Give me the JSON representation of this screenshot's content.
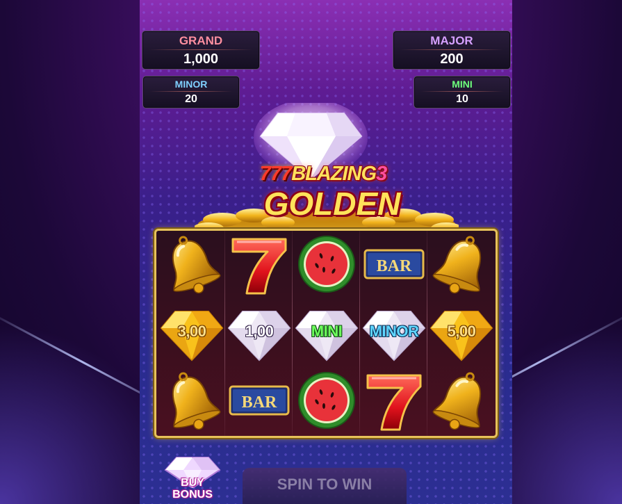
{
  "jackpots": {
    "grand": {
      "label": "GRAND",
      "value": "1,000",
      "color": "#ff8fa0"
    },
    "major": {
      "label": "MAJOR",
      "value": "200",
      "color": "#d6a0ff"
    },
    "minor": {
      "label": "MINOR",
      "value": "20",
      "color": "#7fd0ff"
    },
    "mini": {
      "label": "MINI",
      "value": "10",
      "color": "#6dff7c"
    }
  },
  "logo": {
    "sevens": "777",
    "blazing": "BLAZING",
    "number": "3",
    "golden": "GOLDEN"
  },
  "reels": [
    [
      "bell",
      "gold-gem",
      "bell"
    ],
    [
      "seven",
      "white-gem",
      "bar"
    ],
    [
      "watermelon",
      "white-gem",
      "watermelon"
    ],
    [
      "bar",
      "white-gem",
      "seven"
    ],
    [
      "bell",
      "gold-gem",
      "bell"
    ]
  ],
  "gem_labels": {
    "r0c1": "3,00",
    "r1c1": "1,00",
    "r2c1": "MINI",
    "r3c1": "MINOR",
    "r4c1": "5,00"
  },
  "bar_label": "BAR",
  "buy_bonus": {
    "line1": "BUY",
    "line2": "BONUS"
  },
  "spin_button": "SPIN TO WIN",
  "colors": {
    "frame": "#e7c25a",
    "gold": "#ffd23a",
    "gem_value": "#ffe08a"
  }
}
